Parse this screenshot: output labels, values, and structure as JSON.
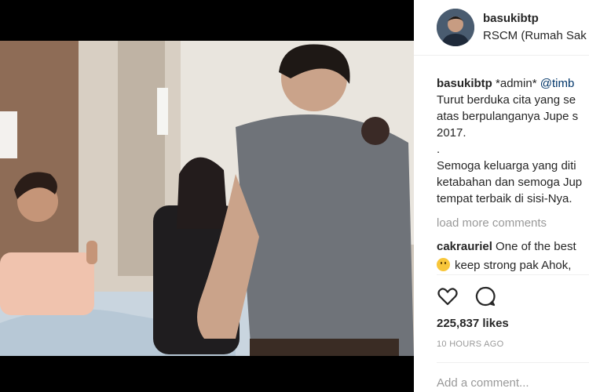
{
  "post": {
    "username": "basukibtp",
    "location": "RSCM (Rumah Sak"
  },
  "caption": {
    "username": "basukibtp",
    "text_after_user": " *admin* ",
    "mention": "@timb",
    "lines": [
      "Turut berduka cita yang se",
      "atas berpulanganya Jupe s",
      "2017.",
      ".",
      "Semoga keluarga yang diti",
      "ketabahan dan semoga Jup",
      "tempat terbaik di sisi-Nya."
    ]
  },
  "load_more": "load more comments",
  "comment": {
    "username": "cakrauriel",
    "text1": " One of the best",
    "text2": "keep strong pak Ahok,"
  },
  "likes": "225,837 likes",
  "timestamp": "10 HOURS AGO",
  "add_comment_placeholder": "Add a comment...",
  "icons": {
    "like": "heart-icon",
    "comment": "comment-bubble-icon",
    "emoji": "smiling-emoji-icon"
  },
  "colors": {
    "mention": "#003569",
    "muted": "#999999",
    "text": "#262626"
  }
}
